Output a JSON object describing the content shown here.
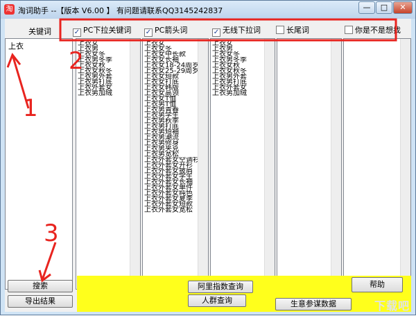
{
  "window": {
    "title": "淘词助手 --【版本 V6.00 】  有问题请联系QQ3145242837",
    "min_label": "—",
    "max_label": "□",
    "close_label": "✕"
  },
  "keyword_label": "关键词",
  "keyword_value": "上衣",
  "checkboxes": [
    {
      "label": "PC下拉关键词",
      "checked": true
    },
    {
      "label": "PC箭头词",
      "checked": true
    },
    {
      "label": "无线下拉词",
      "checked": true
    },
    {
      "label": "长尾词",
      "checked": false
    },
    {
      "label": "你是不是想找",
      "checked": false
    }
  ],
  "columns": [
    [
      "上衣女",
      "上衣男",
      "上衣女冬",
      "上衣男冬季",
      "上衣女秋",
      "上衣女秋冬",
      "上衣男外套",
      "上衣男打底",
      "上衣外套女",
      "上衣男加绒"
    ],
    [
      "上衣女",
      "上衣女冬",
      "上衣女中长款",
      "上衣女长袖",
      "上衣女18-24周岁",
      "上衣女25-29周岁",
      "上衣女短款",
      "上衣女打底",
      "上衣女韩版",
      "上衣女高领",
      "上衣女T恤",
      "上衣男T恤",
      "上衣男青春",
      "上衣男学生",
      "上衣男秋季",
      "上衣男打底",
      "上衣男短袖",
      "上衣男潮流",
      "上衣男修身",
      "上衣男夹克",
      "上衣男宽松",
      "上衣外套女空调衫",
      "上衣外套女开衫",
      "上衣外套女披肩",
      "上衣外套女学生",
      "上衣外套女长袖",
      "上衣外套女单件",
      "上衣外套女纯色",
      "上衣外套女夏季",
      "上衣外套女短款",
      "上衣外套女宽松"
    ],
    [
      "上衣女",
      "上衣男",
      "上衣女冬",
      "上衣男冬季",
      "上衣女秋",
      "上衣女秋冬",
      "上衣男外套",
      "上衣男打底",
      "上衣外套女",
      "上衣男加绒"
    ]
  ],
  "buttons": {
    "search": "搜索",
    "export": "导出结果",
    "ali_index": "阿里指数查询",
    "crowd": "人群查询",
    "help": "帮助",
    "business": "生意参谋数据"
  },
  "annotations": {
    "one": "1",
    "two": "2",
    "three": "3",
    "color": "#e8241f"
  },
  "watermark": "下载吧"
}
